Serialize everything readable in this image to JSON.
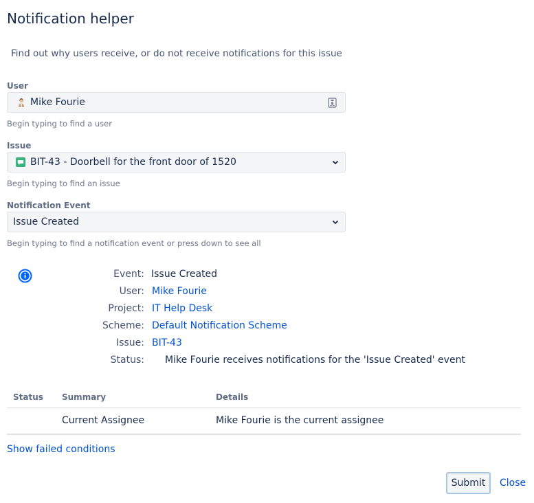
{
  "dialog": {
    "title": "Notification helper",
    "subtitle": "Find out why users receive, or do not receive notifications for this issue"
  },
  "form": {
    "user": {
      "label": "User",
      "value": "Mike Fourie",
      "help": "Begin typing to find a user"
    },
    "issue": {
      "label": "Issue",
      "value": "BIT-43 - Doorbell for the front door of 1520",
      "help": "Begin typing to find an issue"
    },
    "event": {
      "label": "Notification Event",
      "value": "Issue Created",
      "help": "Begin typing to find a notification event or press down to see all"
    }
  },
  "result": {
    "event_key": "Event:",
    "event_value": "Issue Created",
    "user_key": "User:",
    "user_value": "Mike Fourie",
    "project_key": "Project:",
    "project_value": "IT Help Desk",
    "scheme_key": "Scheme:",
    "scheme_value": "Default Notification Scheme",
    "issue_key": "Issue:",
    "issue_value": "BIT-43",
    "status_key": "Status:",
    "status_value": "Mike Fourie receives notifications for the 'Issue Created' event"
  },
  "table": {
    "headers": {
      "status": "Status",
      "summary": "Summary",
      "details": "Details"
    },
    "rows": [
      {
        "status": "",
        "summary": "Current Assignee",
        "details": "Mike Fourie is the current assignee"
      }
    ]
  },
  "links": {
    "show_failed": "Show failed conditions"
  },
  "footer": {
    "submit_label": "Submit",
    "close_label": "Close"
  },
  "icons": {
    "info": "info-icon",
    "avatar": "user-avatar-icon",
    "issue_type": "service-request-icon",
    "clear": "clear-field-icon",
    "chevron": "chevron-down-icon"
  },
  "colors": {
    "link": "#0052cc",
    "text": "#172b4d",
    "muted": "#6b778c",
    "issue_icon": "#36b37e",
    "info_icon": "#0065ff"
  }
}
